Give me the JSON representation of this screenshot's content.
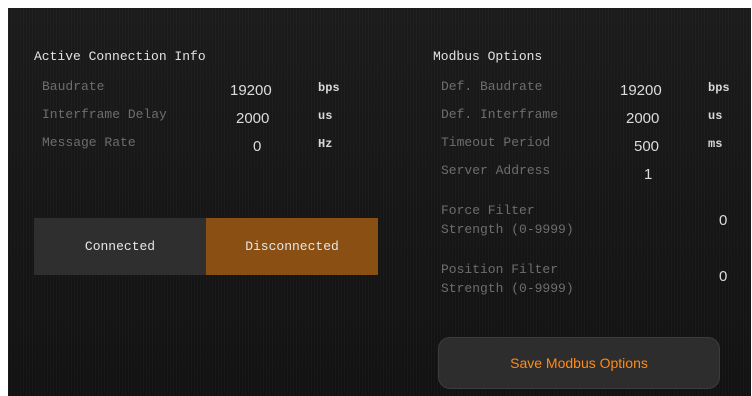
{
  "active_connection": {
    "title": "Active Connection Info",
    "rows": [
      {
        "label": "Baudrate",
        "value": "19200",
        "unit": "bps"
      },
      {
        "label": "Interframe Delay",
        "value": "2000",
        "unit": "us"
      },
      {
        "label": "Message Rate",
        "value": "0",
        "unit": "Hz"
      }
    ]
  },
  "connection_toggle": {
    "connected_label": "Connected",
    "disconnected_label": "Disconnected",
    "active": "Disconnected",
    "active_color": "#8a4f12"
  },
  "modbus_options": {
    "title": "Modbus Options",
    "rows": [
      {
        "label": "Def. Baudrate",
        "value": "19200",
        "unit": "bps"
      },
      {
        "label": "Def. Interframe",
        "value": "2000",
        "unit": "us"
      },
      {
        "label": "Timeout Period",
        "value": "500",
        "unit": "ms"
      },
      {
        "label": "Server Address",
        "value": "1",
        "unit": ""
      }
    ],
    "filters": [
      {
        "label_line1": "Force Filter",
        "label_line2": "Strength (0-9999)",
        "value": "0"
      },
      {
        "label_line1": "Position Filter",
        "label_line2": "Strength (0-9999)",
        "value": "0"
      }
    ],
    "save_label": "Save Modbus Options",
    "accent_color": "#ff8a17"
  }
}
